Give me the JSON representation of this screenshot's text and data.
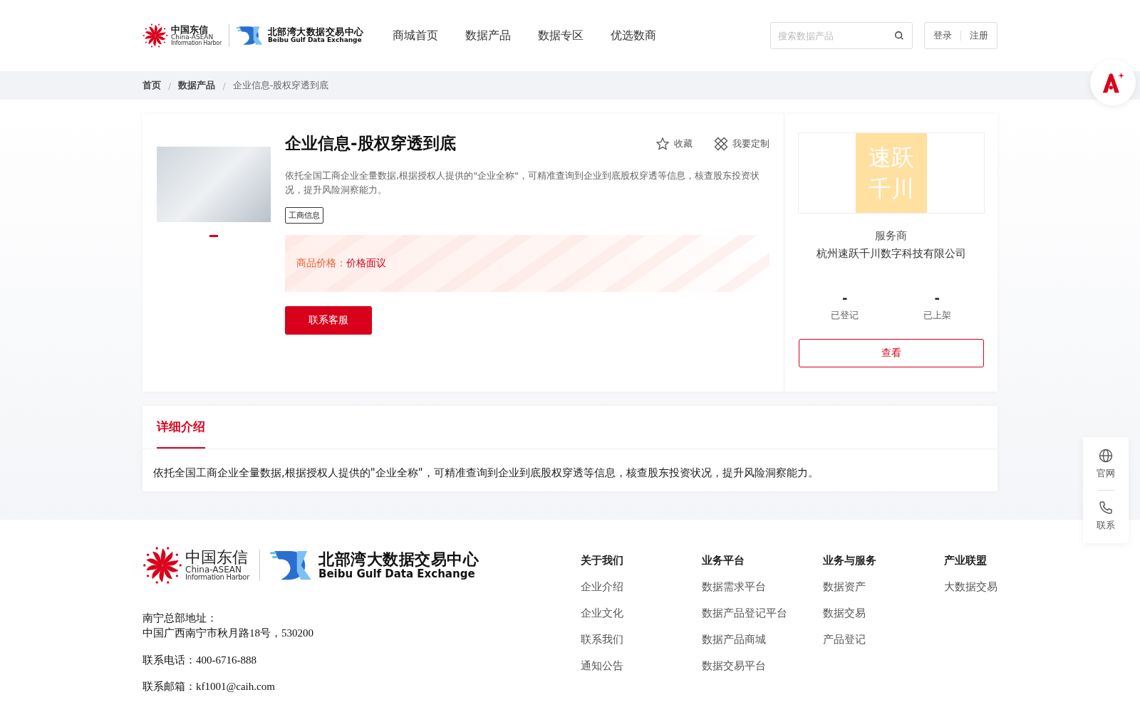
{
  "header": {
    "logo": {
      "brand_cn": "中国东信",
      "brand_en_1": "China-ASEAN",
      "brand_en_2": "Information Harbor",
      "exchange_cn": "北部湾大数据交易中心",
      "exchange_en": "Beibu Gulf Data Exchange"
    },
    "nav": [
      "商城首页",
      "数据产品",
      "数据专区",
      "优选数商"
    ],
    "search": {
      "placeholder": "搜索数据产品"
    },
    "auth": [
      "登录",
      "注册"
    ]
  },
  "breadcrumb": {
    "separator": "/",
    "items": [
      {
        "label": "首页",
        "kind": "link"
      },
      {
        "label": "数据产品",
        "kind": "link"
      },
      {
        "label": "企业信息-股权穿透到底",
        "kind": "current"
      }
    ]
  },
  "product": {
    "title": "企业信息-股权穿透到底",
    "actions": [
      {
        "label": "收藏",
        "kind": "favorite"
      },
      {
        "label": "我要定制",
        "kind": "customize"
      }
    ],
    "description": "依托全国工商企业全量数据,根据授权人提供的\"企业全称\"，可精准查询到企业到底股权穿透等信息，核查股东投资状况，提升风险洞察能力。",
    "tags": [
      "工商信息"
    ],
    "image_dots": [
      {
        "selected": true
      }
    ],
    "price_label": "商品价格：",
    "price_value": "价格面议",
    "contact_button": "联系客服"
  },
  "provider": {
    "logo_lines": [
      "速跃",
      "千川"
    ],
    "role": "服务商",
    "name": "杭州速跃千川数字科技有限公司",
    "stats": [
      {
        "value": "-",
        "label": "已登记"
      },
      {
        "value": "-",
        "label": "已上架"
      }
    ],
    "view_button": "查看"
  },
  "detail": {
    "tabs": [
      {
        "label": "详细介绍",
        "selected": true
      }
    ],
    "text": "依托全国工商企业全量数据,根据授权人提供的\"企业全称\"，可精准查询到企业到底股权穿透等信息，核查股东投资状况，提升风险洞察能力。"
  },
  "footer": {
    "logo": {
      "brand_cn": "中国东信",
      "brand_en_1": "China-ASEAN",
      "brand_en_2": "Information Harbor",
      "exchange_cn": "北部湾大数据交易中心",
      "exchange_en": "Beibu Gulf Data Exchange"
    },
    "address_label": "南宁总部地址：",
    "address": "中国广西南宁市秋月路18号，530200",
    "phone": "联系电话：400-6716-888",
    "email": "联系邮箱：kf1001@caih.com",
    "columns": [
      {
        "title": "关于我们",
        "links": [
          "企业介绍",
          "企业文化",
          "联系我们",
          "通知公告"
        ]
      },
      {
        "title": "业务平台",
        "links": [
          "数据需求平台",
          "数据产品登记平台",
          "数据产品商城",
          "数据交易平台"
        ]
      },
      {
        "title": "业务与服务",
        "links": [
          "数据资产",
          "数据交易",
          "产品登记"
        ]
      },
      {
        "title": "产业联盟",
        "links": [
          "大数据交易"
        ]
      }
    ]
  },
  "side_tools": [
    {
      "label": "官网",
      "kind": "globe"
    },
    {
      "label": "联系",
      "kind": "phone"
    }
  ]
}
